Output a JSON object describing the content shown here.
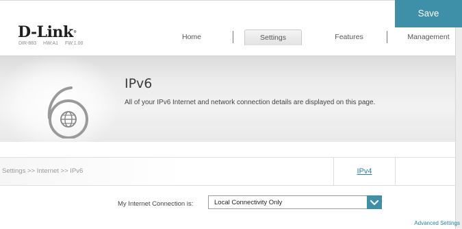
{
  "brand": {
    "logo_text": "D-Link",
    "model": "DIR-883",
    "hw": "HW:A1",
    "fw": "FW:1.00"
  },
  "nav": {
    "items": [
      {
        "label": "Home"
      },
      {
        "label": "Settings",
        "active": true
      },
      {
        "label": "Features"
      },
      {
        "label": "Management"
      }
    ]
  },
  "page": {
    "title": "IPv6",
    "description": "All of your IPv6 Internet and network connection details are displayed on this page.",
    "icon": "ipv6-six-globe-icon"
  },
  "breadcrumb": "Settings >> Internet >> IPv6",
  "actions": {
    "ipv4_label": "IPv4",
    "save_label": "Save"
  },
  "connection": {
    "label": "My Internet Connection is:",
    "selected": "Local Connectivity Only"
  },
  "advanced_link": "Advanced Settings",
  "colors": {
    "accent": "#3e8fa8",
    "link": "#2a7fa8"
  }
}
